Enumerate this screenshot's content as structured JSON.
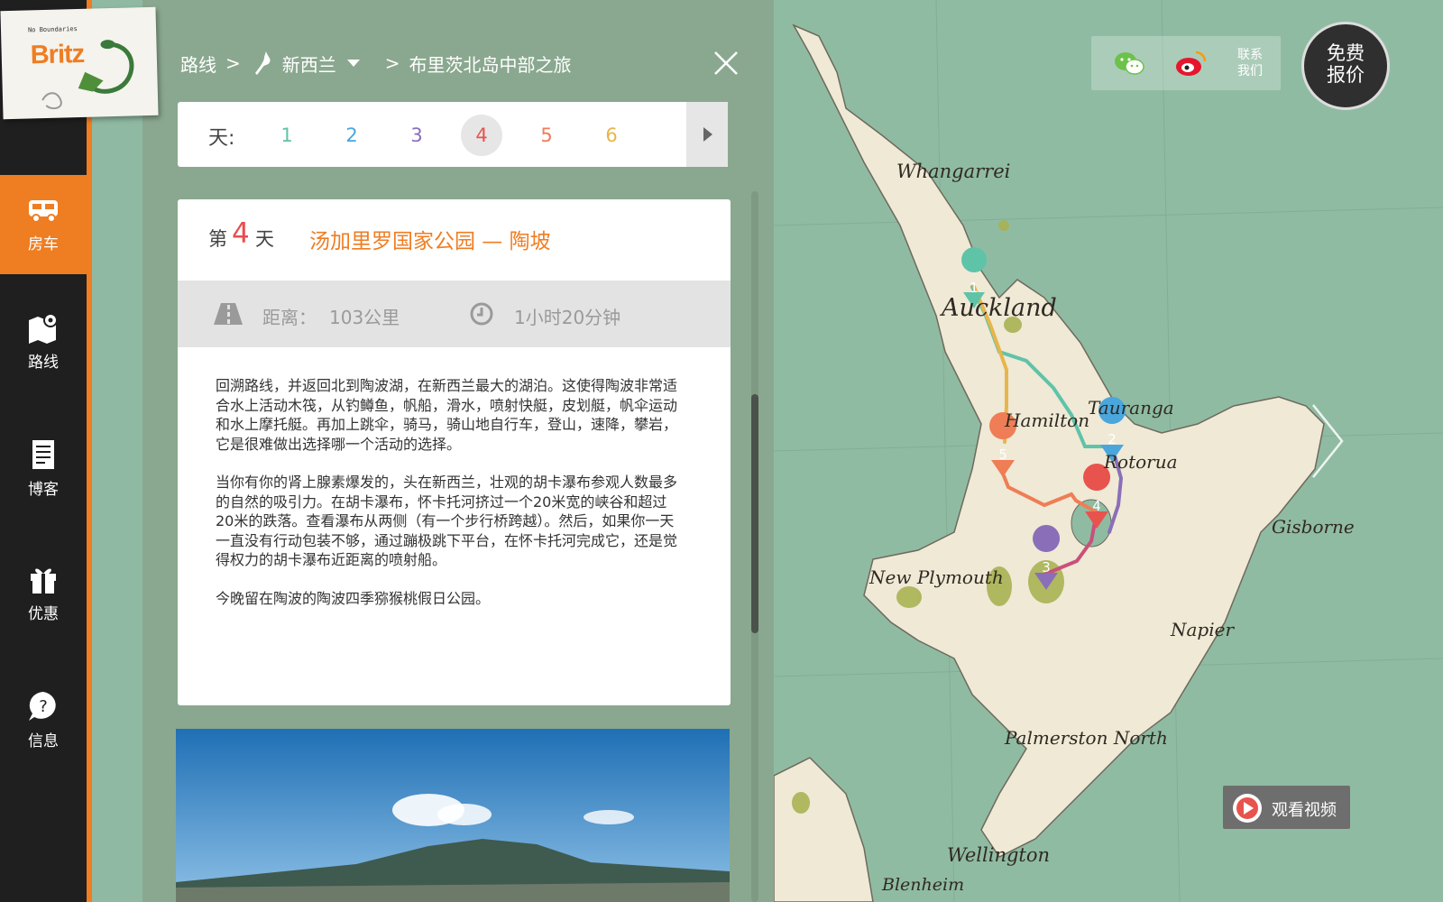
{
  "logo": {
    "tagline": "No Boundaries",
    "brand": "Britz"
  },
  "sidebar": {
    "items": [
      {
        "label": "房车",
        "icon": "campervan-icon",
        "active": true
      },
      {
        "label": "路线",
        "icon": "map-pin-icon",
        "active": false
      },
      {
        "label": "博客",
        "icon": "blog-icon",
        "active": false
      },
      {
        "label": "优惠",
        "icon": "gift-icon",
        "active": false
      },
      {
        "label": "信息",
        "icon": "info-question-icon",
        "active": false
      }
    ]
  },
  "breadcrumb": {
    "root": "路线",
    "sep1": ">",
    "country": "新西兰",
    "sep2": ">",
    "trip": "布里茨北岛中部之旅"
  },
  "days": {
    "label": "天:",
    "items": [
      {
        "num": "1",
        "color": "#5fc3a8"
      },
      {
        "num": "2",
        "color": "#4aa6dc"
      },
      {
        "num": "3",
        "color": "#8a6fb8"
      },
      {
        "num": "4",
        "color": "#e8534d"
      },
      {
        "num": "5",
        "color": "#ef7d55"
      },
      {
        "num": "6",
        "color": "#e8b54b"
      }
    ],
    "current": "4"
  },
  "card": {
    "day_prefix": "第",
    "day_num": "4",
    "day_suffix": "天",
    "title": "汤加里罗国家公园 — 陶坡",
    "distance_label": "距离：",
    "distance_value": "103公里",
    "duration": "1小时20分钟",
    "paragraphs": [
      "回溯路线，并返回北到陶波湖，在新西兰最大的湖泊。这使得陶波非常适合水上活动木筏，从钓鳟鱼，帆船，滑水，喷射快艇，皮划艇，帆伞运动和水上摩托艇。再加上跳伞，骑马，骑山地自行车，登山，速降，攀岩，它是很难做出选择哪一个活动的选择。",
      "当你有你的肾上腺素爆发的，头在新西兰，壮观的胡卡瀑布参观人数最多的自然的吸引力。在胡卡瀑布，怀卡托河挤过一个20米宽的峡谷和超过20米的跌落。查看瀑布从两侧（有一个步行桥跨越）。然后，如果你一天一直没有行动包装不够，通过蹦极跳下平台，在怀卡托河完成它，还是觉得权力的胡卡瀑布近距离的喷射船。",
      "今晚留在陶波的陶波四季猕猴桃假日公园。"
    ]
  },
  "map": {
    "cities": [
      "Whangarrei",
      "Auckland",
      "Tauranga",
      "Hamilton",
      "Rotorua",
      "Gisborne",
      "New Plymouth",
      "Napier",
      "Palmerston North",
      "Wellington",
      "Blenheim"
    ],
    "markers": [
      "1",
      "2",
      "3",
      "4",
      "5"
    ],
    "route_colors": [
      "#5fc3a8",
      "#4aa6dc",
      "#8a6fb8",
      "#e8534d",
      "#ef7d55",
      "#e8b54b"
    ]
  },
  "top_tools": {
    "wechat_icon": "wechat-icon",
    "weibo_icon": "weibo-icon",
    "contact_line1": "联系",
    "contact_line2": "我们",
    "quote_line1": "免费",
    "quote_line2": "报价"
  },
  "video": {
    "label": "观看视频"
  }
}
